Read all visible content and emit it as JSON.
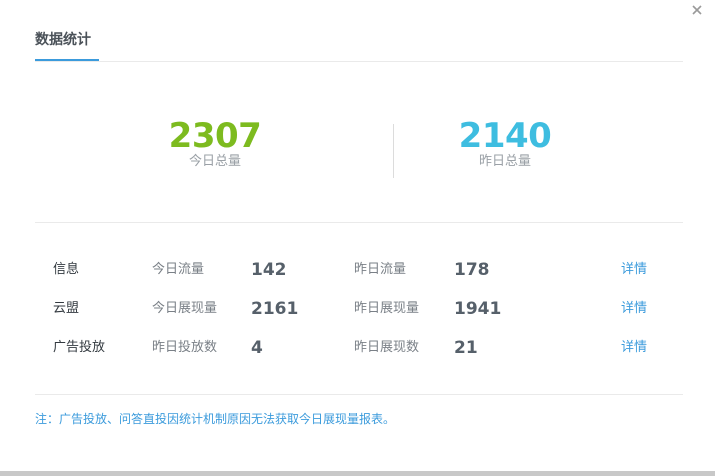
{
  "dialog": {
    "close_icon": "close-icon",
    "tab_label": "数据统计"
  },
  "totals": {
    "today": {
      "value": "2307",
      "label": "今日总量",
      "color": "#7dbb1f"
    },
    "yesterday": {
      "value": "2140",
      "label": "昨日总量",
      "color": "#3ebde0"
    }
  },
  "rows": [
    {
      "category": "信息",
      "label1": "今日流量",
      "value1": "142",
      "label2": "昨日流量",
      "value2": "178",
      "link": "详情"
    },
    {
      "category": "云盟",
      "label1": "今日展现量",
      "value1": "2161",
      "label2": "昨日展现量",
      "value2": "1941",
      "link": "详情"
    },
    {
      "category": "广告投放",
      "label1": "昨日投放数",
      "value1": "4",
      "label2": "昨日展现数",
      "value2": "21",
      "link": "详情"
    }
  ],
  "note": "注：广告投放、问答直投因统计机制原因无法获取今日展现量报表。",
  "colors": {
    "accent": "#3b9bdc",
    "today": "#7dbb1f",
    "yesterday": "#3ebde0"
  }
}
